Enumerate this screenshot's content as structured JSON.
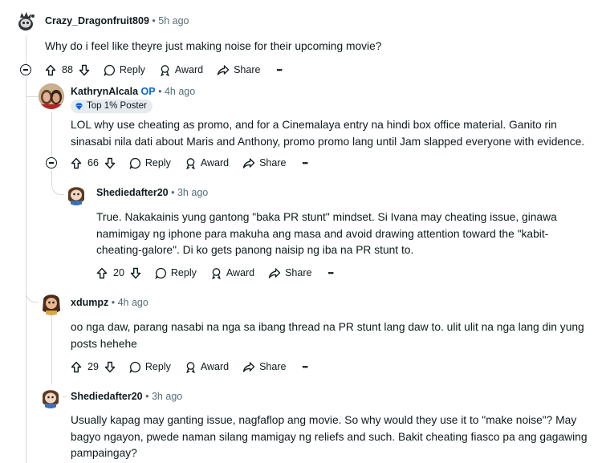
{
  "comments": [
    {
      "username": "Crazy_Dragonfruit809",
      "time": "5h ago",
      "body": "Why do i feel like theyre just making noise for their upcoming movie?",
      "votes": "88",
      "reply_label": "Reply",
      "award_label": "Award",
      "share_label": "Share",
      "more_label": "•••"
    },
    {
      "username": "KathrynAlcala",
      "op_label": "OP",
      "time": "4h ago",
      "badge": "Top 1% Poster",
      "body": "LOL why use cheating as promo, and for a Cinemalaya entry na hindi box office material. Ganito rin sinasabi nila dati about Maris and Anthony, promo promo lang until Jam slapped everyone with evidence.",
      "votes": "66",
      "reply_label": "Reply",
      "award_label": "Award",
      "share_label": "Share",
      "more_label": "•••"
    },
    {
      "username": "Shediedafter20",
      "time": "3h ago",
      "body": "True. Nakakainis yung gantong \"baka PR stunt\" mindset. Si Ivana may cheating issue, ginawa namimigay ng iphone para makuha ang masa and avoid drawing attention toward the \"kabit-cheating-galore\". Di ko gets panong naisip ng iba na PR stunt to.",
      "votes": "20",
      "reply_label": "Reply",
      "award_label": "Award",
      "share_label": "Share",
      "more_label": "•••"
    },
    {
      "username": "xdumpz",
      "time": "4h ago",
      "body": "oo nga daw, parang nasabi na nga sa ibang thread na PR stunt lang daw to. ulit ulit na nga lang din yung posts hehehe",
      "votes": "29",
      "reply_label": "Reply",
      "award_label": "Award",
      "share_label": "Share",
      "more_label": "•••"
    },
    {
      "username": "Shediedafter20",
      "time": "3h ago",
      "body": "Usually kapag may ganting issue, nagfaflop ang movie. So why would they use it to \"make noise\"? May bagyo ngayon, pwede naman silang mamigay ng reliefs and such. Bakit cheating fiasco pa ang gagawing pampaingay?"
    }
  ],
  "separator": "•",
  "colors": {
    "op": "#0a66d8",
    "meta": "#576f76",
    "badge_bg": "#e5ebee",
    "line": "#d6dadb"
  }
}
